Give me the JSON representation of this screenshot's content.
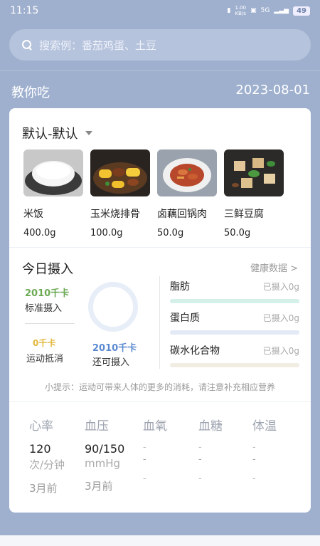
{
  "status_bar": {
    "time": "11:15",
    "speed_value": "1.00",
    "speed_unit": "KB/s",
    "signal": "5G",
    "battery": "49"
  },
  "search": {
    "placeholder": "搜索例：番茄鸡蛋、土豆"
  },
  "section": {
    "title": "教你吃",
    "date": "2023-08-01"
  },
  "plan": {
    "selected": "默认-默认"
  },
  "foods": [
    {
      "name": "米饭",
      "weight": "400.0g",
      "icon": "rice-image"
    },
    {
      "name": "玉米烧排骨",
      "weight": "100.0g",
      "icon": "corn-ribs-image"
    },
    {
      "name": "卤藕回锅肉",
      "weight": "50.0g",
      "icon": "lotus-pork-image"
    },
    {
      "name": "三鲜豆腐",
      "weight": "50.0g",
      "icon": "tofu-image"
    }
  ],
  "intake": {
    "title": "今日摄入",
    "health_link": "健康数据 >",
    "standard_kcal": "2010千卡",
    "standard_label": "标准摄入",
    "exercise_kcal": "0千卡",
    "exercise_label": "运动抵消",
    "remaining_kcal": "2010千卡",
    "remaining_label": "还可摄入",
    "nutrients": [
      {
        "name": "脂肪",
        "value": "已摄入0g",
        "color": "#d5efe9"
      },
      {
        "name": "蛋白质",
        "value": "已摄入0g",
        "color": "#e3eaf6"
      },
      {
        "name": "碳水化合物",
        "value": "已摄入0g",
        "color": "#f2ede3"
      }
    ]
  },
  "tip": "小提示：运动可带来人体的更多的消耗，请注意补充相应营养",
  "vitals": [
    {
      "name": "心率",
      "value": "120",
      "unit": "次/分钟",
      "time": "3月前"
    },
    {
      "name": "血压",
      "value": "90/150",
      "unit": "mmHg",
      "time": "3月前"
    },
    {
      "name": "血氧",
      "value": "-",
      "unit": "-",
      "time": "-"
    },
    {
      "name": "血糖",
      "value": "-",
      "unit": "-",
      "time": "-"
    },
    {
      "name": "体温",
      "value": "-",
      "unit": "-",
      "time": "-"
    }
  ],
  "colors": {
    "background": "#9fb0cf",
    "standard_green": "#6caa55",
    "exercise_yellow": "#e2b73a",
    "remaining_blue": "#5b8ad0"
  }
}
